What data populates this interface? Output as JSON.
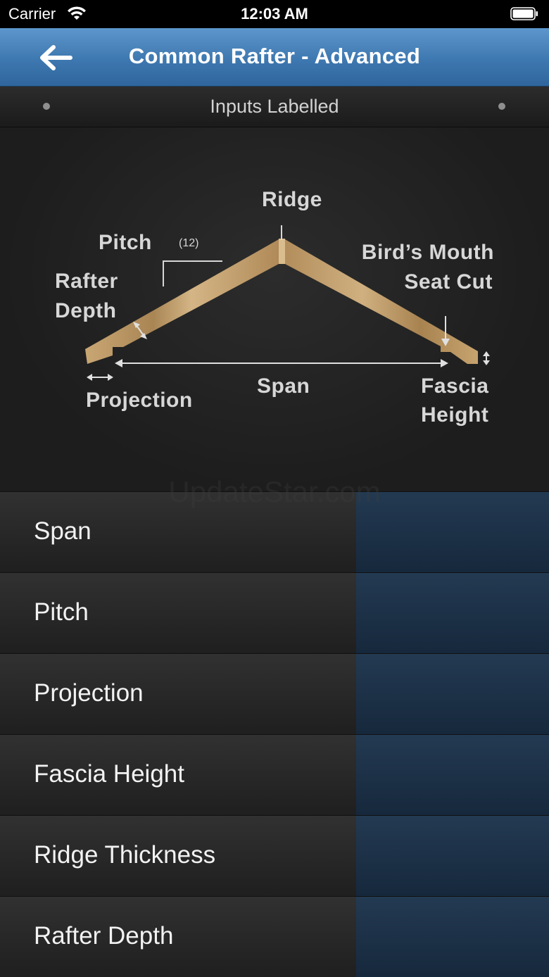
{
  "status_bar": {
    "carrier": "Carrier",
    "time": "12:03 AM"
  },
  "nav": {
    "title": "Common Rafter - Advanced",
    "back_icon": "arrow-left-icon"
  },
  "page_bar": {
    "label": "Inputs Labelled"
  },
  "diagram": {
    "ridge": "Ridge",
    "pitch": "Pitch",
    "pitch_run": "(12)",
    "birds_mouth_line1": "Bird’s Mouth",
    "birds_mouth_line2": "Seat Cut",
    "rafter_depth_line1": "Rafter",
    "rafter_depth_line2": "Depth",
    "projection": "Projection",
    "span": "Span",
    "fascia_line1": "Fascia",
    "fascia_line2": "Height"
  },
  "watermark": "UpdateStar.com",
  "inputs": [
    {
      "label": "Span",
      "value": ""
    },
    {
      "label": "Pitch",
      "value": ""
    },
    {
      "label": "Projection",
      "value": ""
    },
    {
      "label": "Fascia Height",
      "value": ""
    },
    {
      "label": "Ridge Thickness",
      "value": ""
    },
    {
      "label": "Rafter Depth",
      "value": ""
    }
  ],
  "colors": {
    "nav_blue": "#3e78b0",
    "input_blue": "#1c3147",
    "wood": "#b8955f"
  }
}
